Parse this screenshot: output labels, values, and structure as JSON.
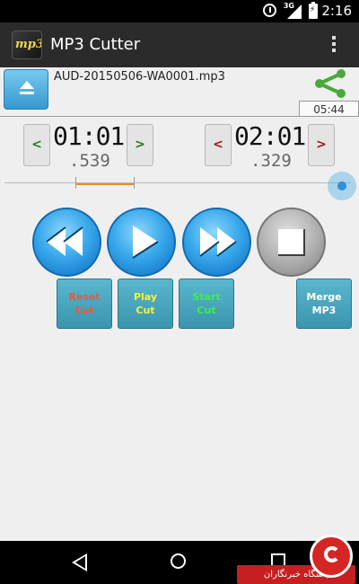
{
  "status_bar": {
    "time": "2:16",
    "network": "3G"
  },
  "app": {
    "title": "MP3 Cutter",
    "logo_text": "mp3"
  },
  "file": {
    "name": "AUD-20150506-WA0001.mp3",
    "total_duration": "05:44"
  },
  "start": {
    "minutes_seconds": "01:01",
    "fraction": ".539",
    "decrement_label": "<",
    "increment_label": ">"
  },
  "end": {
    "minutes_seconds": "02:01",
    "fraction": ".329",
    "decrement_label": "<",
    "increment_label": ">"
  },
  "buttons": {
    "reset": {
      "line1": "Reset",
      "line2": "Cut",
      "color": "#e8593c"
    },
    "play": {
      "line1": "Play",
      "line2": "Cut",
      "color": "#f4f23a"
    },
    "start": {
      "line1": "Start",
      "line2": "Cut",
      "color": "#3cf04a"
    },
    "merge": {
      "line1": "Merge",
      "line2": "MP3",
      "color": "#ffffff"
    }
  },
  "watermark": {
    "text": "باشگاه خبرنگاران"
  },
  "colors": {
    "accent_blue": "#2f8fd8",
    "selection_orange": "#f08c1e",
    "share_green": "#4aaa3c"
  }
}
